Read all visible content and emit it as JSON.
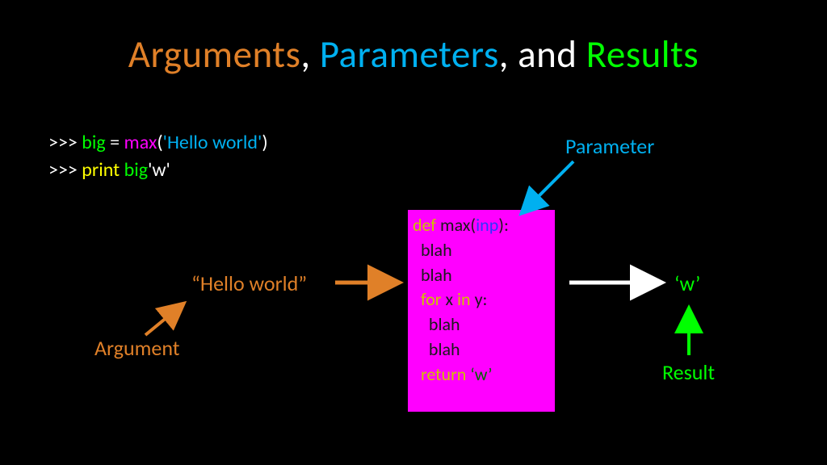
{
  "title": {
    "arguments": "Arguments",
    "comma1": ", ",
    "parameters": "Parameters",
    "comma2": ", and ",
    "results": "Results"
  },
  "code_top": {
    "line1": {
      "prompt": ">>> ",
      "var": "big ",
      "assign": "= ",
      "func": "max",
      "paren_open": "(",
      "literal": "'Hello world'",
      "paren_close": ")"
    },
    "line2": {
      "prompt": ">>> ",
      "print": "print ",
      "big": "big",
      "w": "'w'"
    }
  },
  "argument_text": "“Hello world”",
  "argument_label": "Argument",
  "parameter_label": "Parameter",
  "result_text": "‘w’",
  "result_label": "Result",
  "codebox": {
    "l1_def": "def ",
    "l1_max": "max(",
    "l1_inp": "inp",
    "l1_close": "):",
    "l2": "  blah",
    "l3": "  blah",
    "l4_for": "  for ",
    "l4_x": "x ",
    "l4_in": "in ",
    "l4_y": "y:",
    "l5": "    blah",
    "l6": "    blah",
    "l7_return": "  return ",
    "l7_w": "‘w’"
  }
}
